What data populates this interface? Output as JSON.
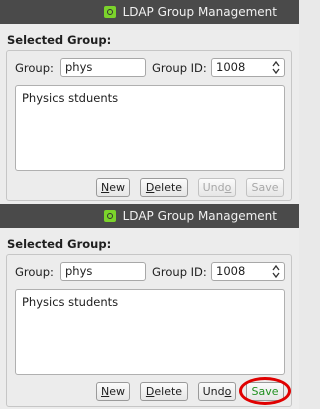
{
  "window_title": "LDAP Group Management",
  "section_title": "Selected Group:",
  "labels": {
    "group": "Group:",
    "group_id": "Group ID:"
  },
  "buttons": {
    "new": "New",
    "delete": "Delete",
    "undo": "Undo",
    "save": "Save"
  },
  "before": {
    "group_value": "phys",
    "group_id_value": "1008",
    "description": "Physics stduents",
    "undo_enabled": false,
    "save_enabled": false
  },
  "after": {
    "group_value": "phys",
    "group_id_value": "1008",
    "description": "Physics students",
    "undo_enabled": true,
    "save_enabled": true,
    "save_highlight_color": "#e00000"
  },
  "colors": {
    "titlebar": "#4a4a4a",
    "app_icon": "#7bd32b",
    "save_active_text": "#1f8f1f"
  },
  "icons": {
    "app": "ldap-app-icon",
    "spinner": "spinner-arrows-icon"
  }
}
